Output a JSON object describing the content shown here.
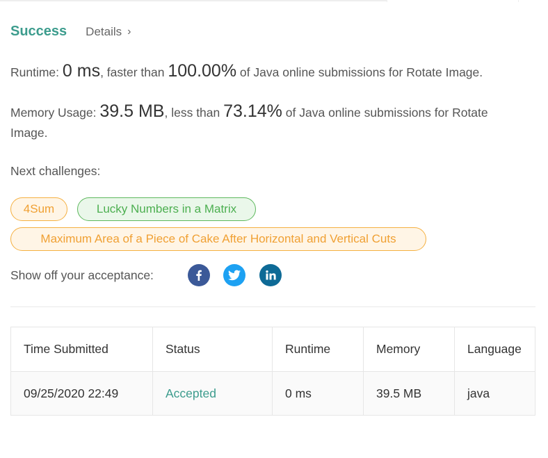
{
  "header": {
    "status": "Success",
    "details_label": "Details",
    "details_chevron": "›"
  },
  "runtime": {
    "label": "Runtime: ",
    "value": "0 ms",
    "text1": ", faster than ",
    "percent": "100.00%",
    "text2": " of Java online submissions for Rotate Image."
  },
  "memory": {
    "label": "Memory Usage: ",
    "value": "39.5 MB",
    "text1": ", less than ",
    "percent": "73.14%",
    "text2": " of Java online submissions for Rotate",
    "text3": "Image."
  },
  "next_challenges": {
    "label": "Next challenges:",
    "items": [
      {
        "title": "4Sum",
        "difficulty_color": "#f0a033"
      },
      {
        "title": "Lucky Numbers in a Matrix",
        "difficulty_color": "#4caf50"
      },
      {
        "title": "Maximum Area of a Piece of Cake After Horizontal and Vertical Cuts",
        "difficulty_color": "#f0a033"
      }
    ]
  },
  "share": {
    "label": "Show off your acceptance:",
    "icons": [
      "facebook-icon",
      "twitter-icon",
      "linkedin-icon"
    ]
  },
  "table": {
    "headers": [
      "Time Submitted",
      "Status",
      "Runtime",
      "Memory",
      "Language"
    ],
    "rows": [
      {
        "time": "09/25/2020 22:49",
        "status": "Accepted",
        "runtime": "0 ms",
        "memory": "39.5 MB",
        "language": "java"
      }
    ]
  },
  "colors": {
    "success": "#3c9c8d",
    "medium": "#f0a033",
    "easy": "#4caf50",
    "facebook": "#3b5998",
    "twitter": "#1da1f2",
    "linkedin": "#0e6a96"
  }
}
